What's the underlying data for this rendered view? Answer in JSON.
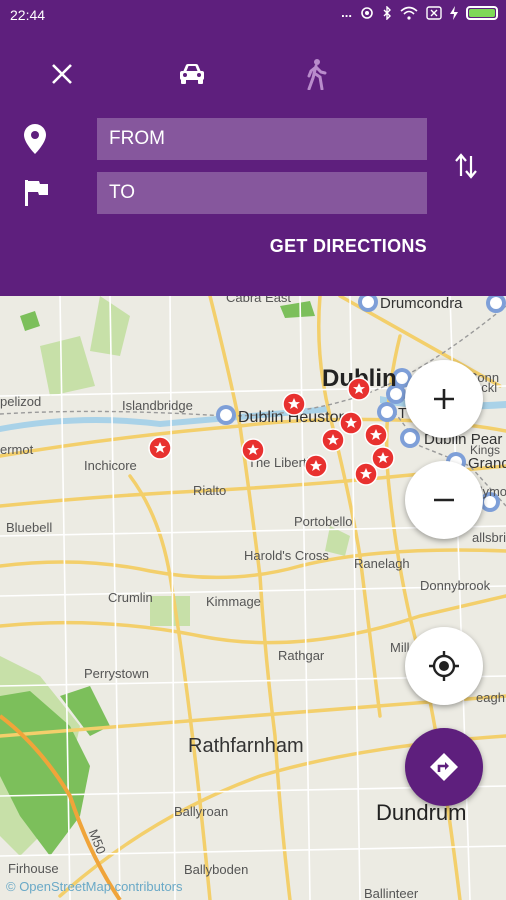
{
  "status_bar": {
    "time": "22:44",
    "dots": "..."
  },
  "directions": {
    "from_placeholder": "FROM",
    "to_placeholder": "TO",
    "get_directions_label": "GET DIRECTIONS"
  },
  "modes": [
    "close",
    "car",
    "walk"
  ],
  "colors": {
    "header": "#5e1f7d",
    "marker": "#e8312f",
    "road": "#f3cf6b",
    "park": "#7cbf5b",
    "water": "#a9d2e8"
  },
  "map": {
    "labels": {
      "cabra_east": "Cabra East",
      "drumcondra": "Drumcondra",
      "dublin": "Dublin",
      "islandbridge": "Islandbridge",
      "dublin_heuston": "Dublin Heuston",
      "chapelizod": "pelizod",
      "ermot": "ermot",
      "inchicore": "Inchicore",
      "the_liberties": "The Liberties",
      "rialto": "Rialto",
      "dublin_pearse": "Dublin Pear",
      "grand": "Grand",
      "bluebell": "Bluebell",
      "portobello": "Portobello",
      "harolds_cross": "Harold's Cross",
      "ranelagh": "Ranelagh",
      "donnybrook": "Donnybrook",
      "crumlin": "Crumlin",
      "kimmage": "Kimmage",
      "rathgar": "Rathgar",
      "mill": "Mill",
      "perrystown": "Perrystown",
      "rathfarnham": "Rathfarnham",
      "ballyroan": "Ballyroan",
      "dundrum": "Dundrum",
      "ballyboden": "Ballyboden",
      "firhouse": "Firhouse",
      "m50": "M50",
      "ballinteer": "Ballinteer",
      "sandymount": "ndymount",
      "ballsbridge": "allsbridge",
      "kings": "Kings",
      "conn": "Conn",
      "ock": "ockl",
      "t": "T",
      "eagh": "eagh"
    },
    "attribution": "© OpenStreetMap contributors"
  },
  "controls": [
    "zoom-in",
    "zoom-out",
    "my-location",
    "directions"
  ]
}
